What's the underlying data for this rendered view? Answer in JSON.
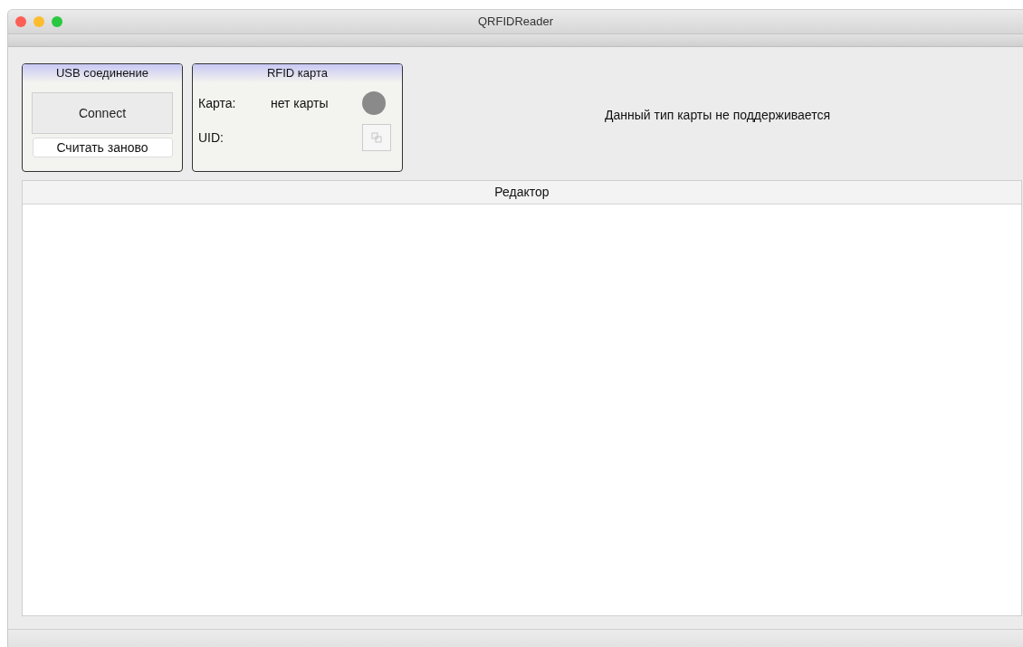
{
  "window": {
    "title": "QRFIDReader"
  },
  "usb_group": {
    "title": "USB соединение",
    "connect_button": "Connect",
    "reread_button": "Считать заново"
  },
  "rfid_group": {
    "title": "RFID карта",
    "card_label": "Карта:",
    "card_value": "нет карты",
    "card_detected": false,
    "uid_label": "UID:",
    "copy_disabled": true
  },
  "message": "Данный тип карты не поддерживается",
  "editor": {
    "title": "Редактор"
  }
}
